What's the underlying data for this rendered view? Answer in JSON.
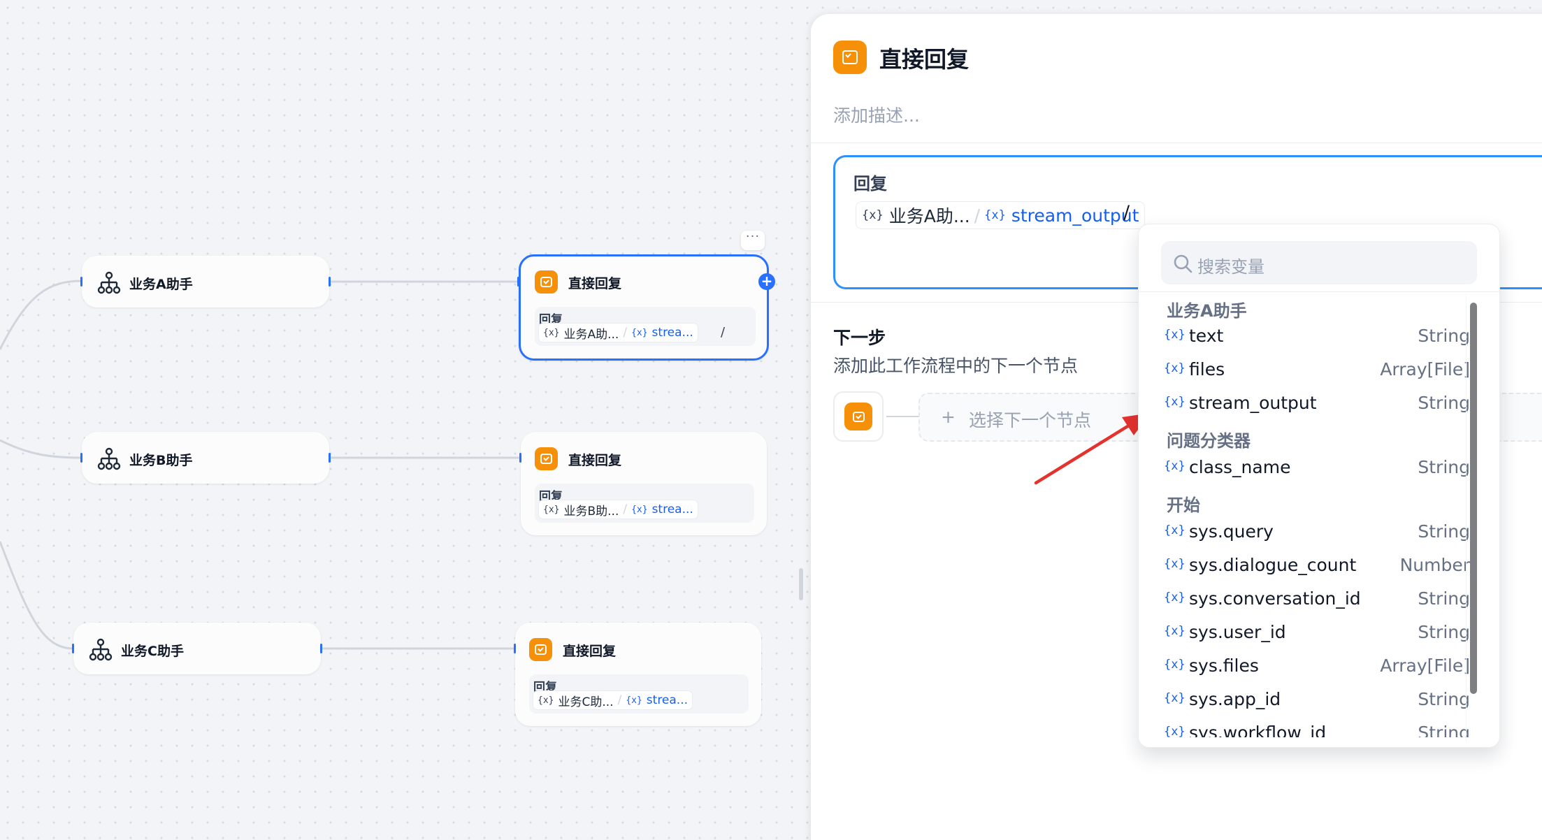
{
  "canvas": {
    "agent_nodes": [
      {
        "title": "业务A助手"
      },
      {
        "title": "业务B助手"
      },
      {
        "title": "业务C助手"
      }
    ],
    "reply_nodes": [
      {
        "title": "直接回复",
        "reply_label": "回复",
        "var_source": "业务A助...",
        "var_name": "strea...",
        "trailing": "/"
      },
      {
        "title": "直接回复",
        "reply_label": "回复",
        "var_source": "业务B助...",
        "var_name": "strea..."
      },
      {
        "title": "直接回复",
        "reply_label": "回复",
        "var_source": "业务C助...",
        "var_name": "strea..."
      }
    ],
    "more_button": "···",
    "plus_button": "+",
    "var_icon": "{x}",
    "separator": "/"
  },
  "panel": {
    "title": "直接回复",
    "description_placeholder": "添加描述...",
    "reply_label": "回复",
    "reply_var_source": "业务A助...",
    "reply_var_name": "stream_output",
    "reply_trailing": "/",
    "next_step_title": "下一步",
    "next_step_desc": "添加此工作流程中的下一个节点",
    "select_next_plus": "+",
    "select_next_text": "选择下一个节点"
  },
  "dropdown": {
    "search_placeholder": "搜索变量",
    "groups": [
      {
        "name": "业务A助手",
        "vars": [
          {
            "name": "text",
            "type": "String"
          },
          {
            "name": "files",
            "type": "Array[File]"
          },
          {
            "name": "stream_output",
            "type": "String"
          }
        ]
      },
      {
        "name": "问题分类器",
        "vars": [
          {
            "name": "class_name",
            "type": "String"
          }
        ]
      },
      {
        "name": "开始",
        "vars": [
          {
            "name": "sys.query",
            "type": "String"
          },
          {
            "name": "sys.dialogue_count",
            "type": "Number"
          },
          {
            "name": "sys.conversation_id",
            "type": "String"
          },
          {
            "name": "sys.user_id",
            "type": "String"
          },
          {
            "name": "sys.files",
            "type": "Array[File]"
          },
          {
            "name": "sys.app_id",
            "type": "String"
          },
          {
            "name": "sys.workflow_id",
            "type": "String"
          }
        ]
      }
    ]
  },
  "colors": {
    "accent": "#2970ff",
    "reply_orange": "#f79009",
    "var_blue": "#155eef",
    "arrow_red": "#e5322d"
  },
  "icons": [
    "agent-tree-icon",
    "reply-icon",
    "variable-icon",
    "search-icon",
    "add-icon",
    "more-icon"
  ]
}
